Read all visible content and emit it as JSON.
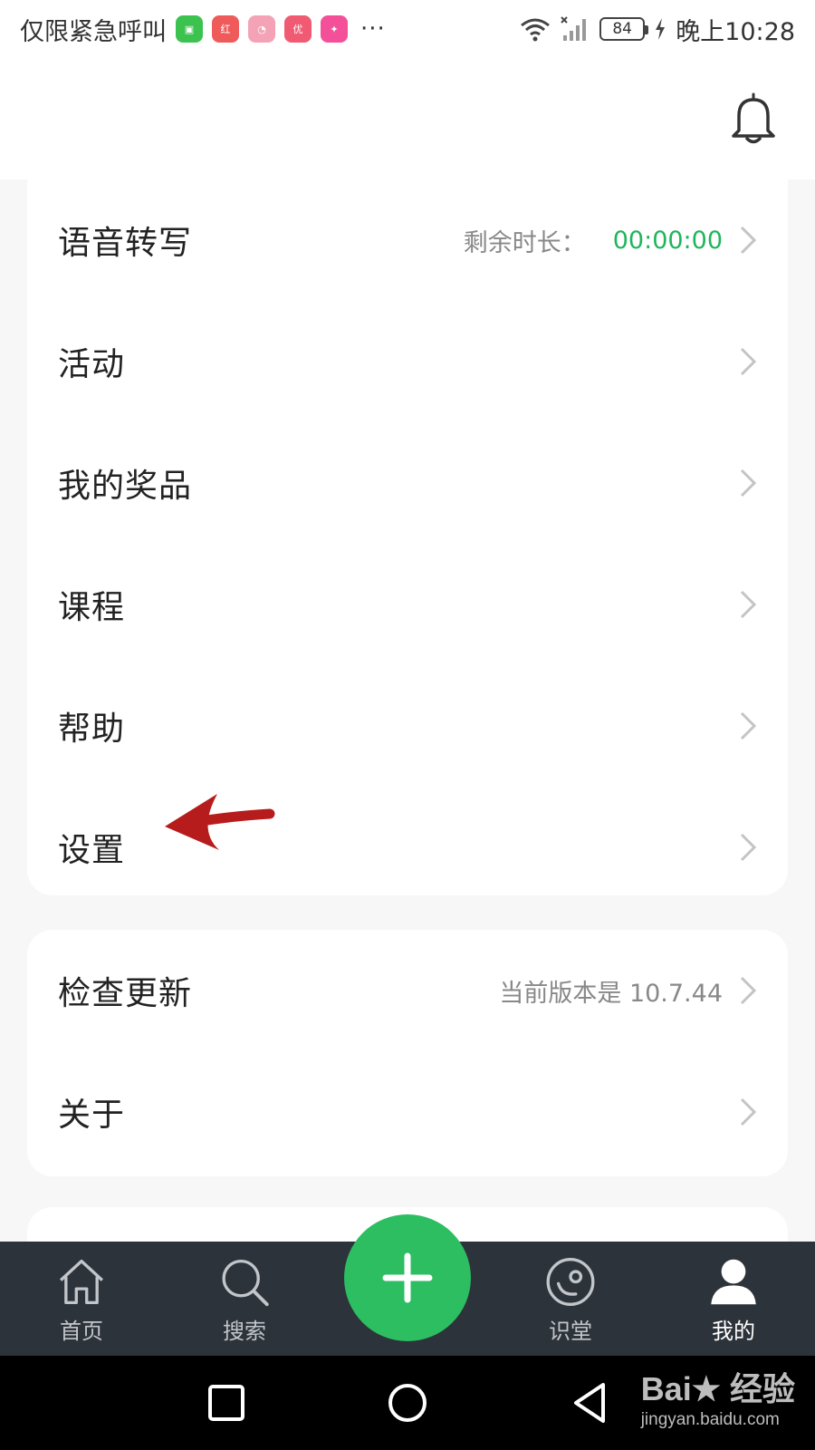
{
  "status_bar": {
    "left_text": "仅限紧急呼叫",
    "app_icons": [
      {
        "name": "reader-app-icon",
        "color": "#3cc34f",
        "glyph": "▣"
      },
      {
        "name": "hongbu-app-icon",
        "color": "#ef5b5b",
        "glyph": "红布"
      },
      {
        "name": "cartoon-app-icon",
        "color": "#f4a3b6",
        "glyph": "◔"
      },
      {
        "name": "youpin-app-icon",
        "color": "#f05b73",
        "glyph": "优"
      },
      {
        "name": "promo-app-icon",
        "color": "#f4509a",
        "glyph": "✦"
      }
    ],
    "more": "···",
    "battery": "84",
    "time": "晚上10:28"
  },
  "menu_main": [
    {
      "label": "语音转写",
      "sub": "剩余时长：",
      "value": "00:00:00"
    },
    {
      "label": "活动"
    },
    {
      "label": "我的奖品"
    },
    {
      "label": "课程"
    },
    {
      "label": "帮助"
    },
    {
      "label": "设置"
    }
  ],
  "menu_second": [
    {
      "label": "检查更新",
      "sub": "当前版本是 10.7.44"
    },
    {
      "label": "关于"
    }
  ],
  "bottom_nav": {
    "items": [
      {
        "label": "首页"
      },
      {
        "label": "搜索"
      },
      {
        "label": "识堂"
      },
      {
        "label": "我的"
      }
    ]
  },
  "watermark": {
    "brand": "Bai★ 经验",
    "url": "jingyan.baidu.com"
  },
  "colors": {
    "accent": "#2cbe61",
    "time_value": "#1fb55b",
    "nav_bg": "#2d333a",
    "annotation_arrow": "#b71c1c"
  }
}
